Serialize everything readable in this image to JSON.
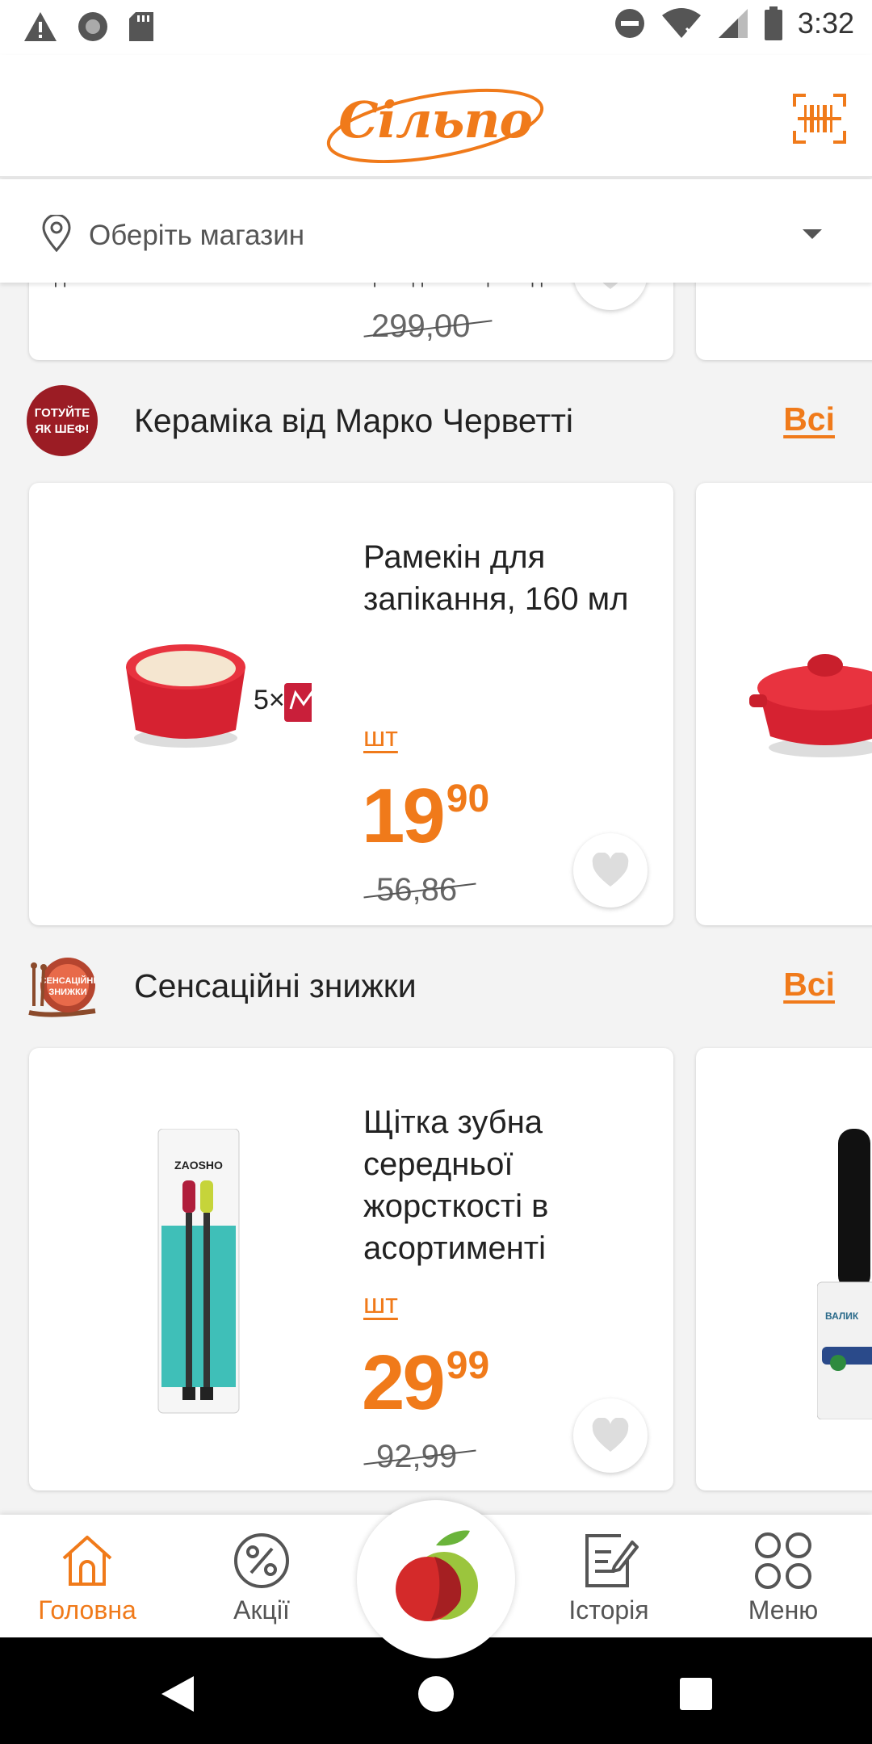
{
  "status_bar": {
    "time": "3:32"
  },
  "header": {
    "logo_text": "Сільпо",
    "brand_color": "#f07a1a"
  },
  "store_picker": {
    "placeholder": "Оберіть магазин"
  },
  "partial_card": {
    "cut_text": "ПІДНІМЕ ЕНЕРГІЮ ІЗ НАТУРАЛЬНИМИ ЛАСОЩАМИ ДЛЯ КРАЩОГО ЗДОРОВ'Я",
    "old_price": "299,00"
  },
  "sections": [
    {
      "badge_text": "ГОТУЙТЕ ЯК ШЕФ!",
      "title": "Кераміка від Марко Черветті",
      "all_label": "Всі",
      "product": {
        "name": "Рамекін для запікання, 160 мл",
        "promo_text": "5×",
        "unit": "шт",
        "price_int": "19",
        "price_dec": "90",
        "old_price": "56,86"
      }
    },
    {
      "badge_text": "СЕНСАЦІЙНІ ЗНИЖКИ",
      "title": "Сенсаційні знижки",
      "all_label": "Всі",
      "product": {
        "name": "Щітка зубна середньої жорсткості в асортименті",
        "brand_on_pack": "ZAOSHO",
        "unit": "шт",
        "price_int": "29",
        "price_dec": "99",
        "old_price": "92,99"
      },
      "peek_text": "ВАЛИК"
    }
  ],
  "bottom_nav": {
    "items": [
      {
        "label": "Головна",
        "icon": "home-icon"
      },
      {
        "label": "Акції",
        "icon": "percent-icon"
      },
      {
        "label": "Історія",
        "icon": "history-icon"
      },
      {
        "label": "Меню",
        "icon": "menu-icon"
      }
    ],
    "center_icon": "apple-icon"
  }
}
